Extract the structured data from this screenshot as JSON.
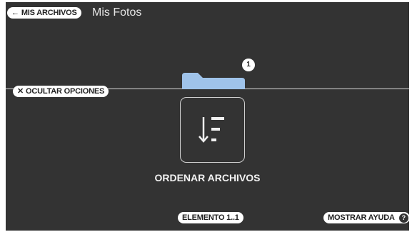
{
  "header": {
    "back_label": "MIS ARCHIVOS",
    "back_icon": "arrow-left-icon",
    "title": "Mis Fotos"
  },
  "options": {
    "hide_label": "OCULTAR OPCIONES",
    "hide_icon": "close-icon"
  },
  "preview": {
    "folder_icon": "folder-icon",
    "count_badge": "1"
  },
  "sort": {
    "icon": "sort-icon",
    "label": "ORDENAR ARCHIVOS"
  },
  "footer": {
    "item_label": "ELEMENTO 1..1",
    "help_label": "MOSTRAR AYUDA",
    "help_icon_text": "?"
  },
  "colors": {
    "background": "#333333",
    "folder": "#9fc3ea",
    "pill": "#ffffff"
  }
}
